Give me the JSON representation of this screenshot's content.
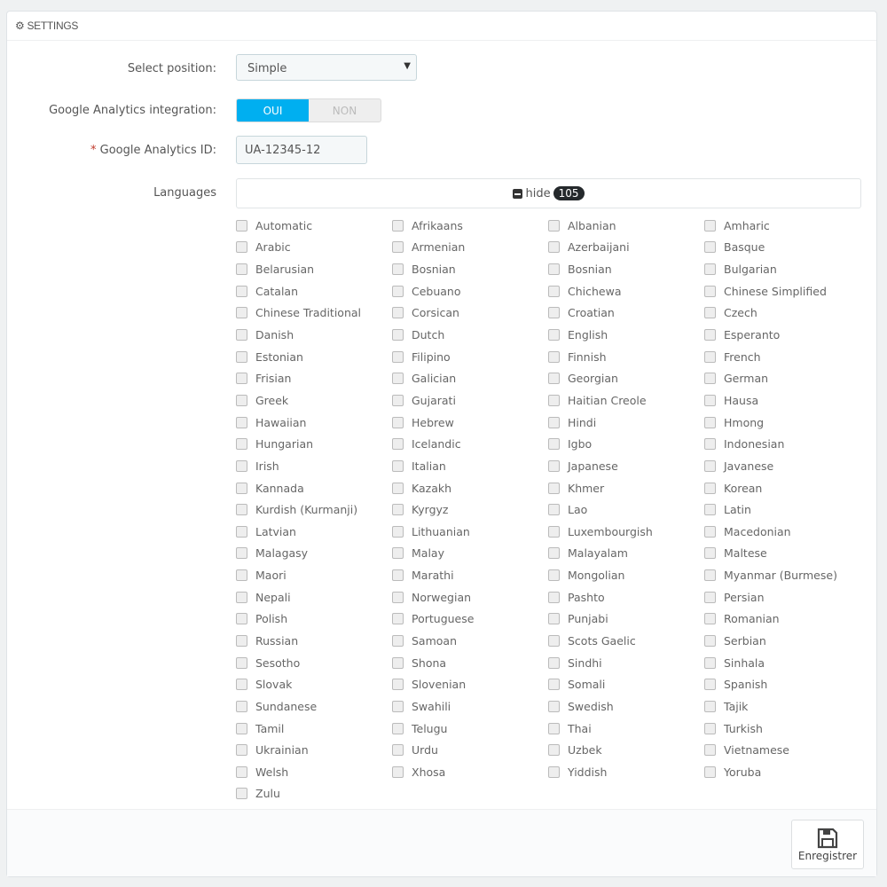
{
  "panel": {
    "title": "SETTINGS",
    "icon": "gears-icon"
  },
  "position": {
    "label": "Select position:",
    "value": "Simple"
  },
  "analytics": {
    "label": "Google Analytics integration:",
    "on": "OUI",
    "off": "NON",
    "selected": "OUI",
    "accent": "#00aff0"
  },
  "ga_id": {
    "required": "*",
    "label": "Google Analytics ID:",
    "value": "UA-12345-12"
  },
  "languages": {
    "label": "Languages",
    "toggle_label": "hide",
    "count": "105",
    "items": [
      "Automatic",
      "Afrikaans",
      "Albanian",
      "Amharic",
      "Arabic",
      "Armenian",
      "Azerbaijani",
      "Basque",
      "Belarusian",
      "Bosnian",
      "Bosnian",
      "Bulgarian",
      "Catalan",
      "Cebuano",
      "Chichewa",
      "Chinese Simplified",
      "Chinese Traditional",
      "Corsican",
      "Croatian",
      "Czech",
      "Danish",
      "Dutch",
      "English",
      "Esperanto",
      "Estonian",
      "Filipino",
      "Finnish",
      "French",
      "Frisian",
      "Galician",
      "Georgian",
      "German",
      "Greek",
      "Gujarati",
      "Haitian Creole",
      "Hausa",
      "Hawaiian",
      "Hebrew",
      "Hindi",
      "Hmong",
      "Hungarian",
      "Icelandic",
      "Igbo",
      "Indonesian",
      "Irish",
      "Italian",
      "Japanese",
      "Javanese",
      "Kannada",
      "Kazakh",
      "Khmer",
      "Korean",
      "Kurdish (Kurmanji)",
      "Kyrgyz",
      "Lao",
      "Latin",
      "Latvian",
      "Lithuanian",
      "Luxembourgish",
      "Macedonian",
      "Malagasy",
      "Malay",
      "Malayalam",
      "Maltese",
      "Maori",
      "Marathi",
      "Mongolian",
      "Myanmar (Burmese)",
      "Nepali",
      "Norwegian",
      "Pashto",
      "Persian",
      "Polish",
      "Portuguese",
      "Punjabi",
      "Romanian",
      "Russian",
      "Samoan",
      "Scots Gaelic",
      "Serbian",
      "Sesotho",
      "Shona",
      "Sindhi",
      "Sinhala",
      "Slovak",
      "Slovenian",
      "Somali",
      "Spanish",
      "Sundanese",
      "Swahili",
      "Swedish",
      "Tajik",
      "Tamil",
      "Telugu",
      "Thai",
      "Turkish",
      "Ukrainian",
      "Urdu",
      "Uzbek",
      "Vietnamese",
      "Welsh",
      "Xhosa",
      "Yiddish",
      "Yoruba",
      "Zulu"
    ]
  },
  "footer": {
    "save_label": "Enregistrer",
    "save_icon": "floppy-disk-icon"
  }
}
